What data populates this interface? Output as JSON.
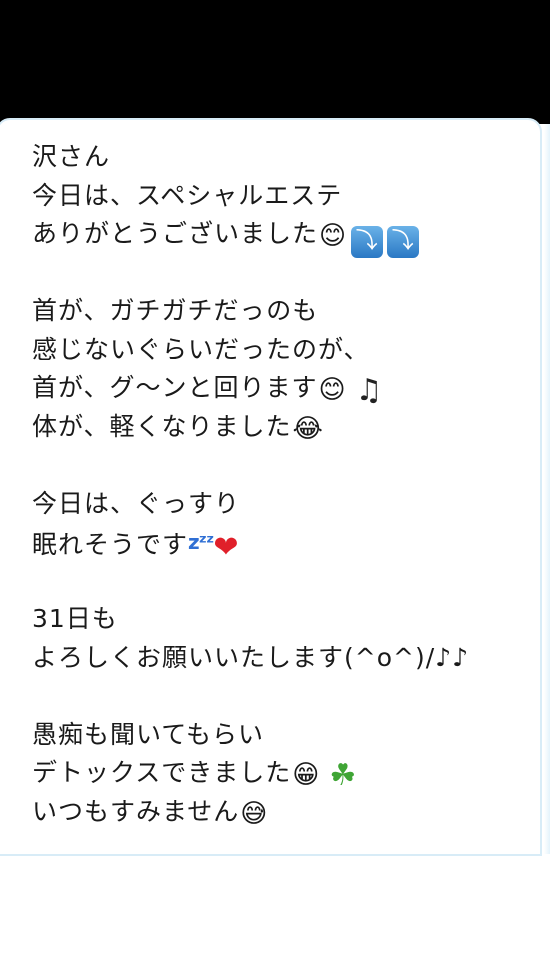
{
  "message": {
    "paragraphs": [
      {
        "lines": [
          {
            "text": "沢さん",
            "emoji": []
          },
          {
            "text": "今日は、スペシャルエステ",
            "emoji": []
          },
          {
            "text": "ありがとうございました",
            "emoji": [
              "smiling-face",
              "arrow-down-right",
              "arrow-down-right"
            ]
          }
        ]
      },
      {
        "lines": [
          {
            "text": "首が、ガチガチだっのも",
            "emoji": []
          },
          {
            "text": "感じないぐらいだったのが、",
            "emoji": []
          },
          {
            "text": "首が、グ〜ンと回ります",
            "emoji": [
              "smiling-face",
              "music-note"
            ]
          },
          {
            "text": "体が、軽くなりました",
            "emoji": [
              "laughing-tears-face"
            ]
          }
        ]
      },
      {
        "lines": [
          {
            "text": "今日は、ぐっすり",
            "emoji": []
          },
          {
            "text": "眠れそうです",
            "emoji": [
              "zzz",
              "red-heart"
            ]
          }
        ]
      },
      {
        "lines": [
          {
            "text": "31日も",
            "emoji": []
          },
          {
            "text": "よろしくお願いいたします(^o^)/♪♪",
            "emoji": []
          }
        ]
      },
      {
        "lines": [
          {
            "text": "愚痴も聞いてもらい",
            "emoji": []
          },
          {
            "text": "デトックスできました",
            "emoji": [
              "grinning-face",
              "four-leaf-clover"
            ]
          },
          {
            "text": "いつもすみません",
            "emoji": [
              "grinning-sweat-face"
            ]
          }
        ]
      }
    ]
  },
  "emoji_glyphs": {
    "smiling-face": "😊",
    "arrow-down-right": "⤵",
    "music-note": "♫",
    "laughing-tears-face": "😂",
    "zzz": "zᶻᶻ",
    "red-heart": "❤",
    "grinning-face": "😁",
    "four-leaf-clover": "☘",
    "grinning-sweat-face": "😅"
  },
  "colors": {
    "top_bar": "#000000",
    "bubble_border": "#d8ecf7",
    "text": "#1a1a1a"
  }
}
